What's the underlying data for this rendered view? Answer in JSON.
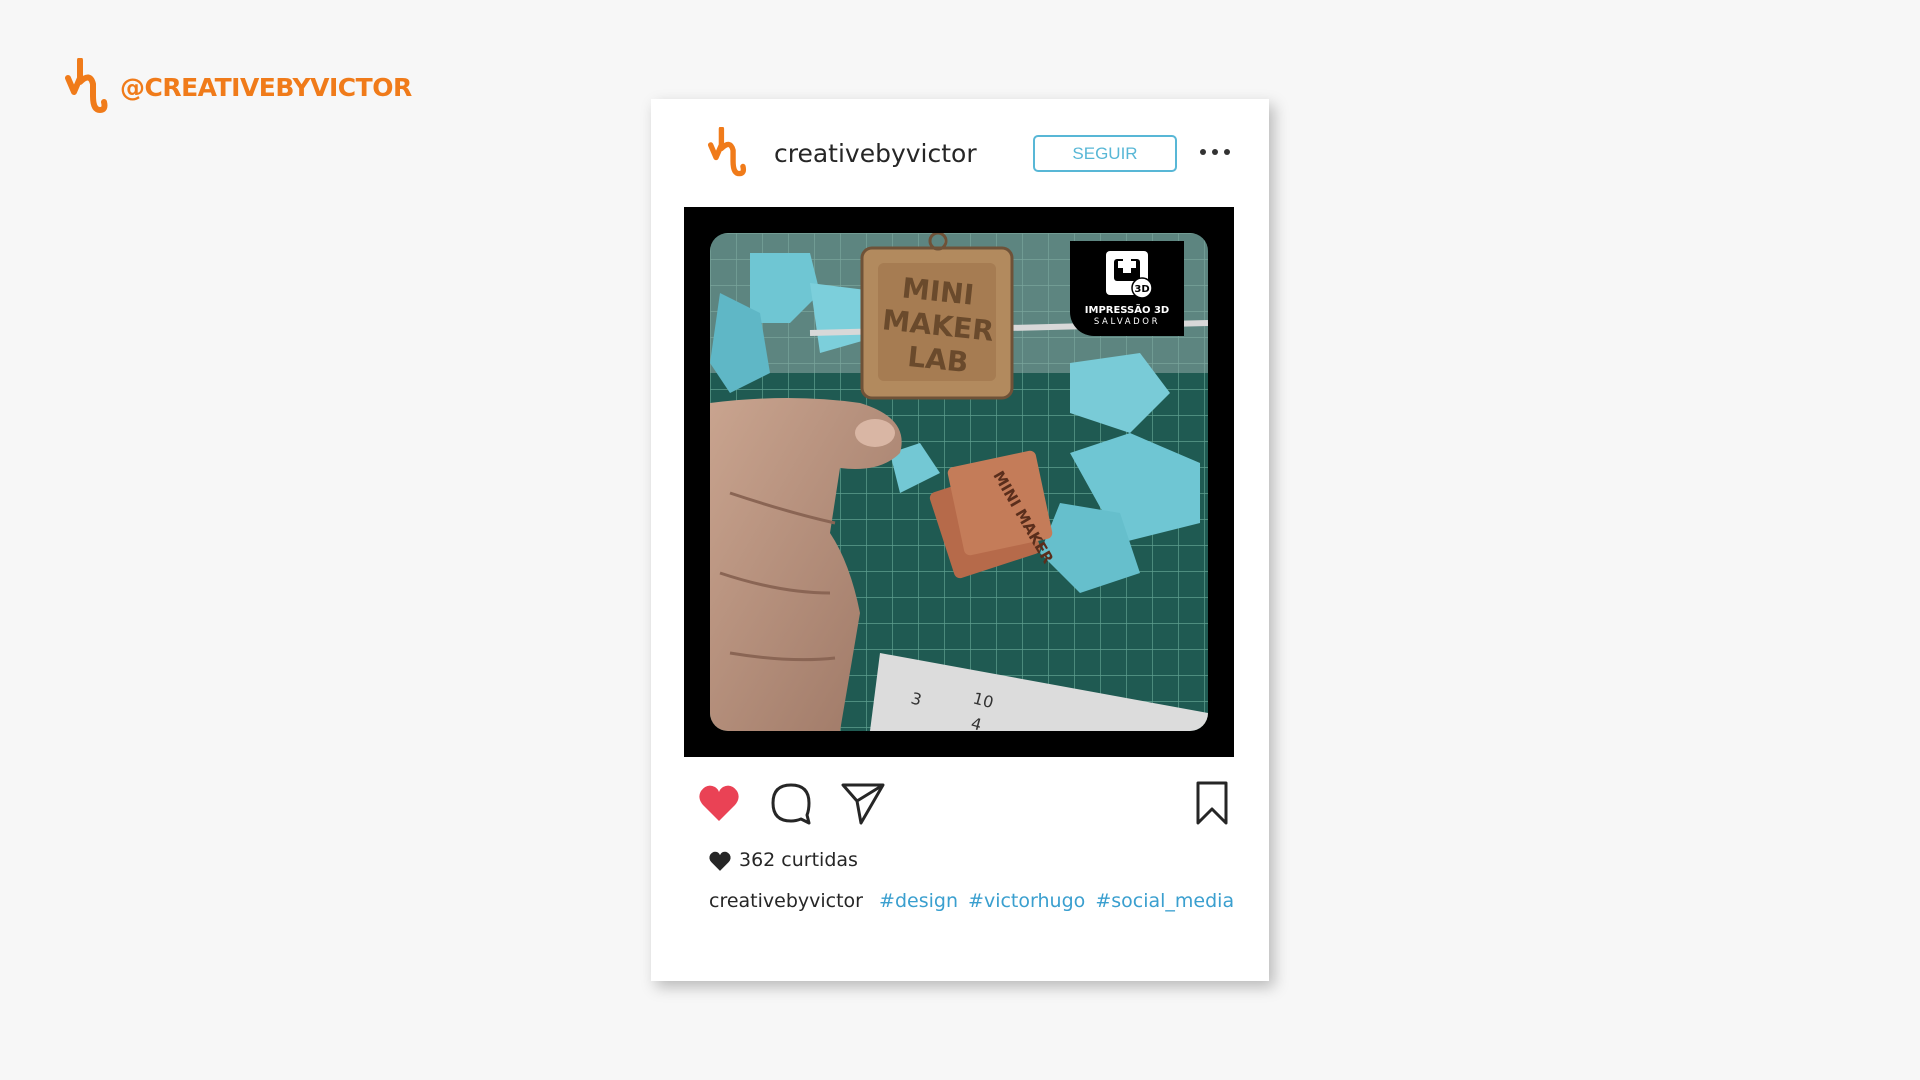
{
  "brand": {
    "handle": "@CREATIVEBYVICTOR",
    "logo_icon": "creativebyvictor-logo-icon",
    "accent_color": "#f07b1a"
  },
  "post": {
    "username": "creativebyvictor",
    "follow_label": "SEGUIR",
    "follow_color": "#58b7d6",
    "more_icon": "more-dots-icon",
    "photo": {
      "keychain_text": [
        "MINI",
        "MAKER",
        "LAB"
      ],
      "watermark_badge": "3D",
      "watermark_line1": "IMPRESSÃO 3D",
      "watermark_line2": "SALVADOR",
      "ruler_numbers": [
        "3",
        "4",
        "10"
      ]
    },
    "actions": {
      "like_icon": "heart-filled-icon",
      "comment_icon": "comment-bubble-icon",
      "share_icon": "send-paper-plane-icon",
      "save_icon": "bookmark-icon",
      "like_color": "#ea4255"
    },
    "likes_label": "362 curtidas",
    "caption_user": "creativebyvictor",
    "hashtags": [
      "#design",
      "#victorhugo",
      "#social_media"
    ],
    "hashtag_color": "#3a9fcf"
  }
}
